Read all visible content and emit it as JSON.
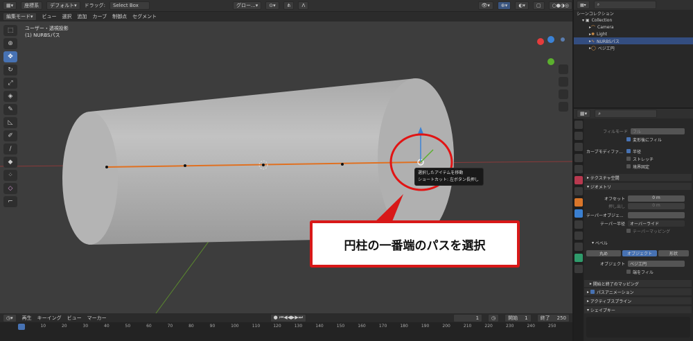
{
  "header": {
    "object_mode": "編集モード",
    "coords_label": "座標系",
    "orientation": "デフォルト",
    "drag_label": "ドラッグ:",
    "drag_value": "Select Box",
    "transform": "グロー...",
    "menu": [
      "ビュー",
      "選択",
      "追加",
      "カーブ",
      "制御点",
      "セグメント"
    ]
  },
  "viewport": {
    "view_name": "ユーザー・透視投影",
    "object_name": "(1) NURBSパス"
  },
  "tooltip": {
    "line1": "選択したアイテムを移動",
    "line2": "ショートカット: 左ボタン長押し"
  },
  "callout": {
    "text": "円柱の一番端のパスを選択"
  },
  "outliner": {
    "scene_collection": "シーンコレクション",
    "collection": "Collection",
    "items": [
      "Camera",
      "Light",
      "NURBSパス",
      "ベジエ円"
    ]
  },
  "properties": {
    "fill_mode_label": "フィルモード",
    "fill_mode_value": "フル",
    "deform_fill": "変形後にフィル",
    "curve_deform_label": "カーブモディファ...",
    "radius": "半径",
    "stretch": "ストレッチ",
    "bounds_clamp": "境界固定",
    "texture_space": "テクスチャ空間",
    "geometry": "ジオメトリ",
    "offset_label": "オフセット",
    "offset_value": "0 m",
    "extrude_label": "押し出し",
    "extrude_value": "0 m",
    "taper_obj_label": "テーパーオブジェ...",
    "taper_radius_label": "テーパー半径",
    "taper_radius_value": "オーバーライド",
    "taper_mapping": "テーパーマッピング",
    "bevel": "ベベル",
    "bevel_tabs": [
      "丸め",
      "オブジェクト",
      "形状"
    ],
    "object_label": "オブジェクト",
    "object_value": "ベジエ円",
    "fill_caps": "端をフィル",
    "start_end_mapping": "開始と終了のマッピング",
    "path_animation": "パスアニメーション",
    "active_spline": "アクティブスプライン",
    "shape_keys": "シェイプキー"
  },
  "timeline": {
    "playback": "再生",
    "keying": "キーイング",
    "view": "ビュー",
    "marker": "マーカー",
    "current_frame": "1",
    "start_label": "開始",
    "start_value": "1",
    "end_label": "終了",
    "end_value": "250",
    "ticks": [
      "1",
      "10",
      "20",
      "30",
      "40",
      "50",
      "60",
      "70",
      "80",
      "90",
      "100",
      "110",
      "120",
      "130",
      "140",
      "150",
      "160",
      "170",
      "180",
      "190",
      "200",
      "210",
      "220",
      "230",
      "240",
      "250"
    ]
  },
  "colors": {
    "selection_blue": "#4772b3",
    "curve_orange": "#e07020",
    "callout_red": "#d81818"
  }
}
